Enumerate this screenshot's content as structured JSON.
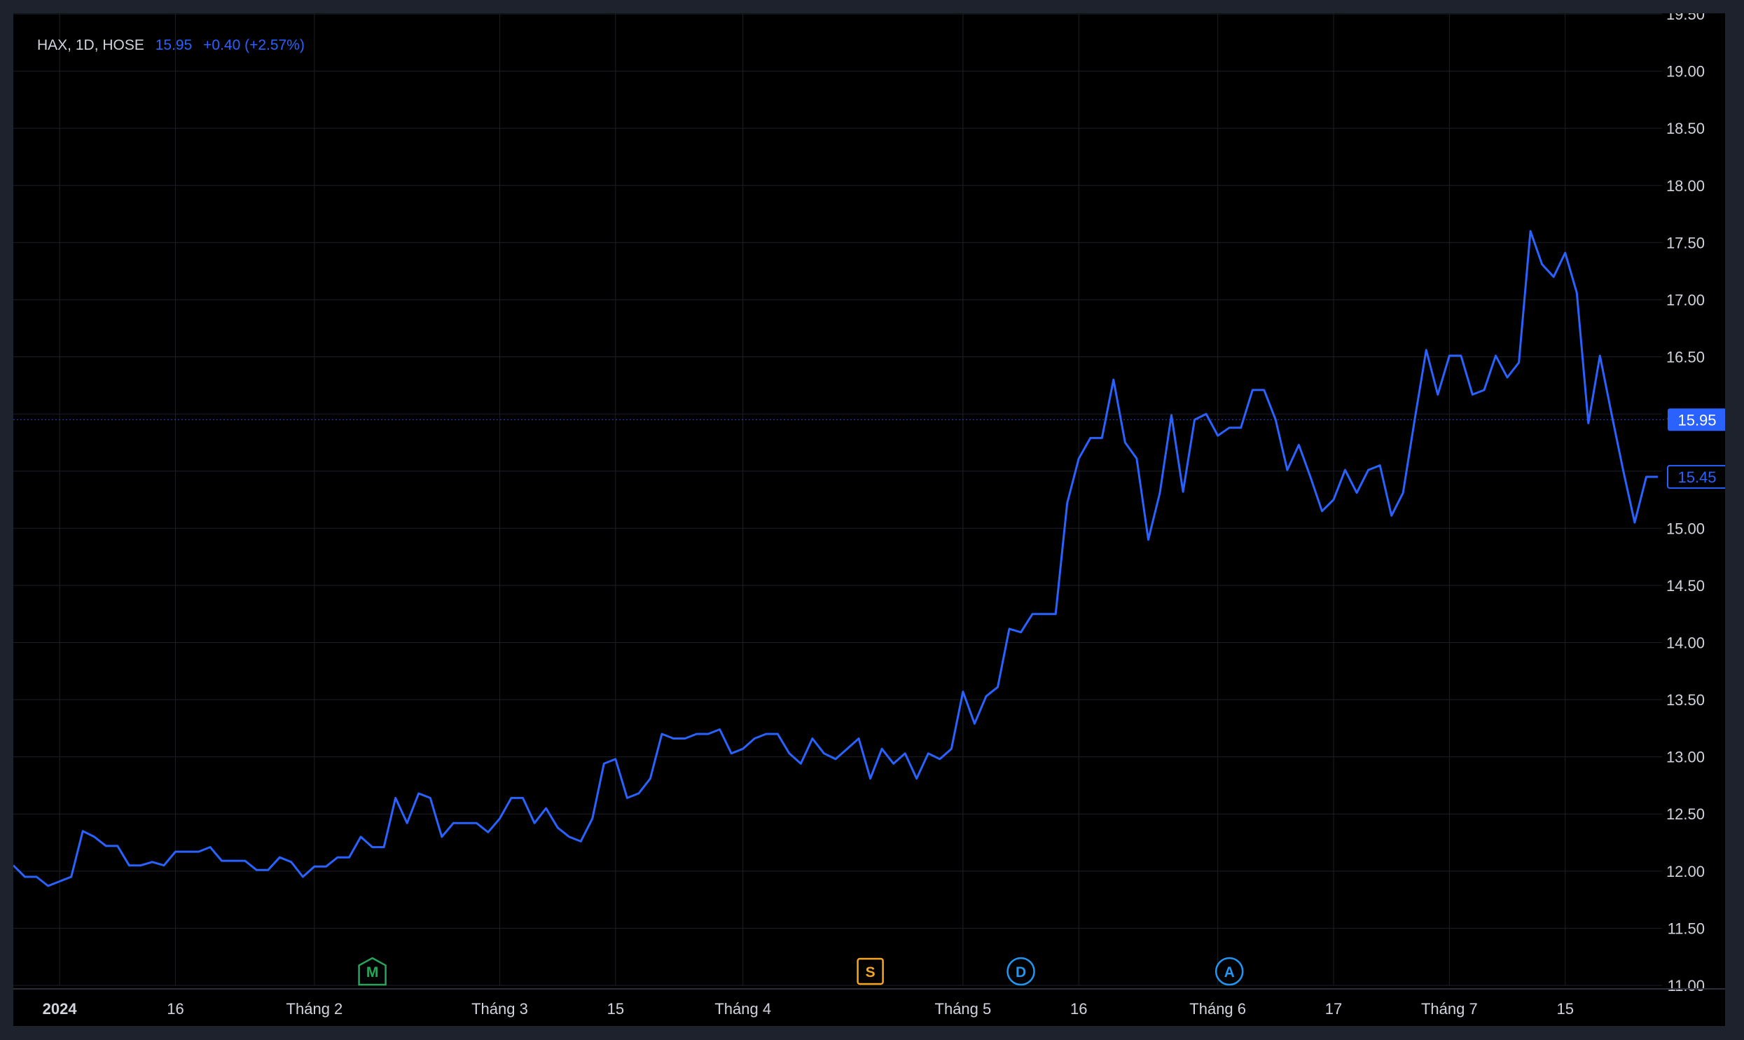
{
  "legend": {
    "symbol": "HAX, 1D, HOSE",
    "price": "15.95",
    "change": "+0.40 (+2.57%)"
  },
  "colors": {
    "background": "#000000",
    "frame": "#1e222d",
    "line": "#2962ff",
    "grid": "#1c1f27",
    "text": "#d1d4dc",
    "event_m": "#26a65b",
    "event_s": "#f5a623",
    "event_d": "#2196f3",
    "event_a": "#2196f3"
  },
  "chart_data": {
    "type": "line",
    "title": "",
    "xlabel": "",
    "ylabel": "",
    "ylim": [
      11.0,
      19.5
    ],
    "grid": true,
    "y_ticks": [
      "11.00",
      "11.50",
      "12.00",
      "12.50",
      "13.00",
      "13.50",
      "14.00",
      "14.50",
      "15.00",
      "15.50",
      "16.00",
      "16.50",
      "17.00",
      "17.50",
      "18.00",
      "18.50",
      "19.00",
      "19.50"
    ],
    "x_ticks": [
      {
        "label": "2024",
        "index": 4
      },
      {
        "label": "16",
        "index": 14
      },
      {
        "label": "Tháng 2",
        "index": 26
      },
      {
        "label": "Tháng 3",
        "index": 42
      },
      {
        "label": "15",
        "index": 52
      },
      {
        "label": "Tháng 4",
        "index": 63
      },
      {
        "label": "Tháng 5",
        "index": 82
      },
      {
        "label": "16",
        "index": 92
      },
      {
        "label": "Tháng 6",
        "index": 104
      },
      {
        "label": "17",
        "index": 114
      },
      {
        "label": "Tháng 7",
        "index": 124
      },
      {
        "label": "15",
        "index": 134
      }
    ],
    "series": [
      {
        "values": [
          12.05,
          11.95,
          11.95,
          11.87,
          11.91,
          11.95,
          12.35,
          12.3,
          12.22,
          12.22,
          12.05,
          12.05,
          12.08,
          12.05,
          12.17,
          12.17,
          12.17,
          12.21,
          12.09,
          12.09,
          12.09,
          12.01,
          12.01,
          12.12,
          12.08,
          11.95,
          12.04,
          12.04,
          12.12,
          12.12,
          12.3,
          12.21,
          12.21,
          12.64,
          12.42,
          12.68,
          12.64,
          12.3,
          12.42,
          12.42,
          12.42,
          12.34,
          12.46,
          12.64,
          12.64,
          12.42,
          12.55,
          12.38,
          12.3,
          12.26,
          12.46,
          12.94,
          12.98,
          12.64,
          12.68,
          12.81,
          13.2,
          13.16,
          13.16,
          13.2,
          13.2,
          13.24,
          13.03,
          13.07,
          13.16,
          13.2,
          13.2,
          13.03,
          12.94,
          13.16,
          13.03,
          12.98,
          13.07,
          13.16,
          12.81,
          13.07,
          12.94,
          13.03,
          12.81,
          13.03,
          12.98,
          13.07,
          13.57,
          13.29,
          13.53,
          13.61,
          14.12,
          14.09,
          14.25,
          14.25,
          14.25,
          15.22,
          15.61,
          15.79,
          15.79,
          16.3,
          15.75,
          15.61,
          14.9,
          15.31,
          15.99,
          15.32,
          15.95,
          16.0,
          15.81,
          15.88,
          15.88,
          16.21,
          16.21,
          15.95,
          15.51,
          15.73,
          15.45,
          15.15,
          15.25,
          15.51,
          15.31,
          15.51,
          15.55,
          15.11,
          15.31,
          15.95,
          16.56,
          16.17,
          16.51,
          16.51,
          16.17,
          16.21,
          16.51,
          16.32,
          16.45,
          17.6,
          17.31,
          17.2,
          17.41,
          17.06,
          15.92,
          16.51,
          16.0,
          15.51,
          15.05,
          15.45,
          15.45
        ]
      }
    ],
    "last_close": 15.45,
    "marked_price": 15.95,
    "events": [
      {
        "label": "M",
        "index": 31,
        "shape": "pentagon"
      },
      {
        "label": "S",
        "index": 74,
        "shape": "square"
      },
      {
        "label": "D",
        "index": 87,
        "shape": "circle"
      },
      {
        "label": "A",
        "index": 105,
        "shape": "circle"
      }
    ]
  }
}
